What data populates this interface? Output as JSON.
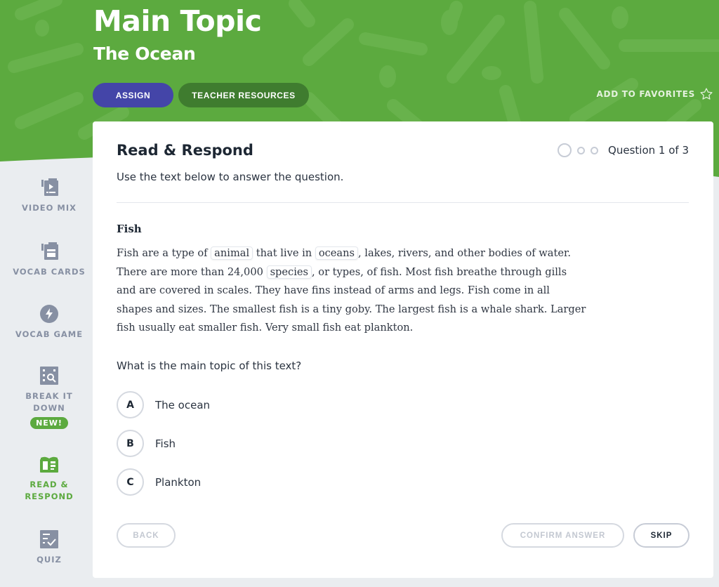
{
  "header": {
    "title": "Main Topic",
    "subtitle": "The Ocean",
    "assign_label": "ASSIGN",
    "teacher_resources_label": "TEACHER RESOURCES",
    "favorites_label": "ADD TO FAVORITES",
    "colors": {
      "brand_green": "#5caa3f",
      "assign_purple": "#4445a8",
      "teacher_dark_green": "#3f7c2f"
    }
  },
  "sidebar": {
    "items": [
      {
        "label": "VIDEO MIX",
        "icon": "video-mix-icon",
        "active": false
      },
      {
        "label": "VOCAB CARDS",
        "icon": "vocab-cards-icon",
        "active": false
      },
      {
        "label": "VOCAB GAME",
        "icon": "lightning-icon",
        "active": false
      },
      {
        "label": "BREAK IT DOWN",
        "icon": "break-it-down-icon",
        "active": false,
        "badge": "NEW!"
      },
      {
        "label": "READ & RESPOND",
        "icon": "open-book-icon",
        "active": true
      },
      {
        "label": "QUIZ",
        "icon": "quiz-checklist-icon",
        "active": false
      }
    ]
  },
  "card": {
    "title": "Read & Respond",
    "instructions": "Use the text below to answer the question.",
    "progress": {
      "current": 1,
      "total": 3,
      "text": "Question 1 of 3"
    },
    "passage": {
      "title": "Fish",
      "segments": [
        {
          "text": "Fish are a type of "
        },
        {
          "text": "animal",
          "vocab": true
        },
        {
          "text": " that live in "
        },
        {
          "text": "oceans",
          "vocab": true
        },
        {
          "text": ", lakes, rivers, and other bodies of water. There are more than 24,000 "
        },
        {
          "text": "species",
          "vocab": true
        },
        {
          "text": ", or types, of fish. Most fish breathe through gills and are covered in scales. They have fins instead of arms and legs. Fish come in all shapes and sizes. The smallest fish is a tiny goby. The largest fish is a whale shark. Larger fish usually eat smaller fish. Very small fish eat plankton."
        }
      ]
    },
    "question": "What is the main topic of this text?",
    "options": [
      {
        "letter": "A",
        "text": "The ocean"
      },
      {
        "letter": "B",
        "text": "Fish"
      },
      {
        "letter": "C",
        "text": "Plankton"
      }
    ],
    "buttons": {
      "back": "BACK",
      "confirm": "CONFIRM ANSWER",
      "skip": "SKIP"
    }
  }
}
